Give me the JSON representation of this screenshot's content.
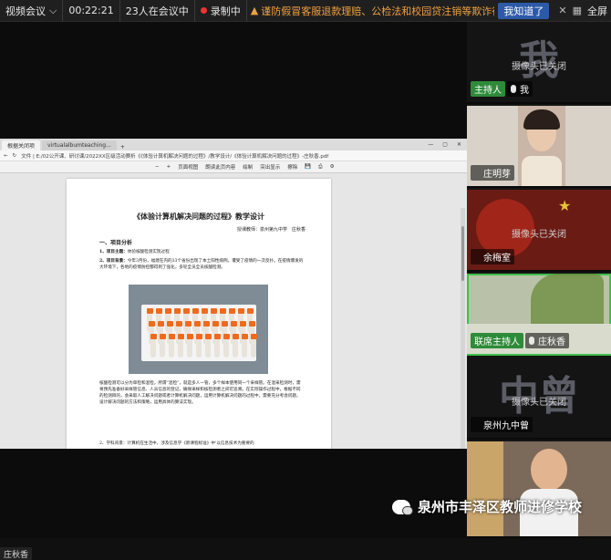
{
  "topbar": {
    "meeting_label": "视频会议",
    "timer": "00:22:21",
    "participants": "23人在会议中",
    "recording": "录制中",
    "warning": "谨防假冒客服退款理赔、公检法和校园贷注销等欺诈行为，不要在“共享",
    "ack": "我知道了",
    "fullscreen": "全屏"
  },
  "browser": {
    "tabs": [
      "根据关闭项",
      "virtualalbumteaching...",
      "+"
    ],
    "address": "文件 | E:/02公开课、研讨课/2022XX区级活动赛析《《体验计算机解决问题的过程》/教学设计/《体验计算机解决问题的过程》-庄秋香.pdf",
    "pdf_toolbar": [
      "页面视图",
      "朗读此页内容",
      "绘制",
      "突出显示",
      "擦除"
    ],
    "page": {
      "title": "《体验计算机解决问题的过程》教学设计",
      "author": "授课教师：泉州第九中学　庄秋香",
      "section1": "一、项目分析",
      "p1_label": "1、项目主题：",
      "p1": "体验核酸检测实现过程",
      "p2_label": "2、项目背景：",
      "p2": "今年3月份，福建在内的33个省份出现了本土阳性病例，遭受了疫情的一次反扑。在疫情爆发的大环境下，各地的疫情防控都得到了强化，多轮全员全员核酸检测。",
      "p3": "核酸检测可以分为单检和混检，所谓“混检”，就是多人一管，多个样本使用同一个采样管。在混采检测时，需将预先准备好采样管信息、人员信息的登记，确保采样和核检测者之间可追溯。在实际操作过程中，根据不同的检测目的，会采取人工解决问题或者计算机解决问题，运用计算机解决问题的过程中，需要充分考虑问题，设计解决问题的方法和策略，运用具体的算法实现。",
      "p4": "2、学科背景：计算机在生活中，涉及信息学《新课程标准》中'以信息技术为重要的"
    }
  },
  "participants": [
    {
      "big": "我",
      "status": "摄像头已关闭",
      "host": "主持人",
      "name": "我",
      "mic": "on"
    },
    {
      "big": "",
      "status": "",
      "host": "",
      "name": "庄明芽",
      "mic": "off"
    },
    {
      "big": "",
      "status": "摄像头已关闭",
      "host": "",
      "name": "余梅室",
      "mic": "off"
    },
    {
      "big": "",
      "status": "",
      "host": "联席主持人",
      "name": "庄秋香",
      "mic": "on"
    },
    {
      "big": "中曾",
      "status": "摄像头已关闭",
      "host": "",
      "name": "泉州九中曾",
      "mic": "off"
    },
    {
      "big": "",
      "status": "",
      "host": "",
      "name": "",
      "mic": "off"
    }
  ],
  "self_label": "庄秋香",
  "watermark": "泉州市丰泽区教师进修学校"
}
